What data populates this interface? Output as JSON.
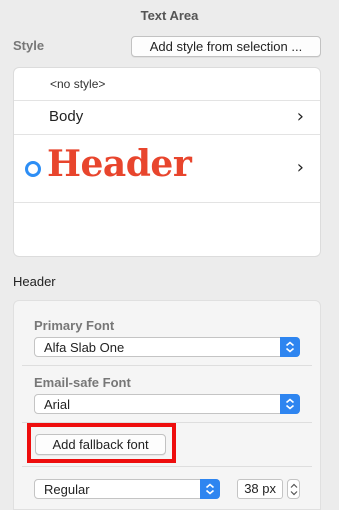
{
  "panel": {
    "title": "Text Area"
  },
  "style_section": {
    "label": "Style",
    "add_button_label": "Add style from selection ..."
  },
  "style_list": {
    "items": [
      {
        "label": "<no style>",
        "selected": false
      },
      {
        "label": "Body",
        "selected": false
      },
      {
        "label": "Header",
        "selected": true,
        "preview_color": "#e8452d"
      }
    ]
  },
  "font_section": {
    "label": "Header",
    "primary_font": {
      "label": "Primary Font",
      "value": "Alfa Slab One"
    },
    "email_safe_font": {
      "label": "Email-safe Font",
      "value": "Arial"
    },
    "fallback_button_label": "Add fallback font",
    "weight": {
      "value": "Regular"
    },
    "size": {
      "value": "38 px"
    }
  },
  "colors": {
    "accent": "#2e85f0",
    "highlight_outline": "#ee0d0d",
    "header_preview": "#e8452d"
  },
  "icons": {
    "row_chevron": "chevron-right-icon",
    "select_cap": "chevron-updown-icon",
    "selected_indicator": "radio-selected-icon"
  }
}
